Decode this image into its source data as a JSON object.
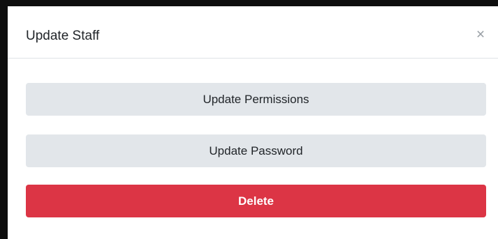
{
  "modal": {
    "title": "Update Staff",
    "close_glyph": "×",
    "close_icon": "close-icon"
  },
  "actions": {
    "update_permissions_label": "Update Permissions",
    "update_password_label": "Update Password",
    "delete_label": "Delete"
  },
  "colors": {
    "secondary_button_bg": "#e2e6ea",
    "danger_button_bg": "#dc3545",
    "backdrop": "#0e0e0e"
  }
}
